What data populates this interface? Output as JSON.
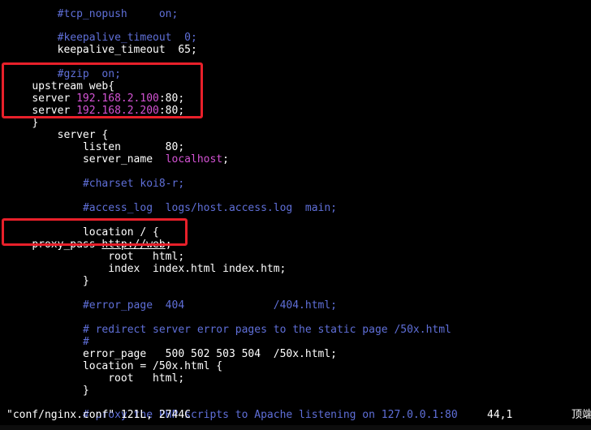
{
  "editor": {
    "lines": {
      "l1": {
        "indent": "    ",
        "text": "#tcp_nopush     on;"
      },
      "l2": {
        "indent": "    ",
        "text": "#keepalive_timeout  0;"
      },
      "l3": {
        "indent": "    ",
        "text": "keepalive_timeout  65;"
      },
      "l4": {
        "indent": "    ",
        "text": "#gzip  on;"
      },
      "l5": {
        "text": "upstream web{"
      },
      "l6": {
        "key": "server ",
        "ip": "192.168.2.100",
        "rest": ":80;"
      },
      "l7": {
        "key": "server ",
        "ip": "192.168.2.200",
        "rest": ":80;"
      },
      "l8": {
        "text": "}"
      },
      "l9": {
        "indent": "    ",
        "text": "server {"
      },
      "l10": {
        "indent": "        ",
        "text": "listen       80;"
      },
      "l11": {
        "indent": "        ",
        "key": "server_name  ",
        "val": "localhost",
        "rest": ";"
      },
      "l12": {
        "indent": "        ",
        "text": "#charset koi8-r;"
      },
      "l13": {
        "indent": "        ",
        "text": "#access_log  logs/host.access.log  main;"
      },
      "l14": {
        "indent": "        ",
        "text": "location / {"
      },
      "l15": {
        "key": "proxy_pass ",
        "url": "http://web",
        "rest": ";"
      },
      "l16": {
        "indent": "            ",
        "text": "root   html;"
      },
      "l17": {
        "indent": "            ",
        "text": "index  index.html index.htm;"
      },
      "l18": {
        "indent": "        ",
        "text": "}"
      },
      "l19": {
        "indent": "        ",
        "text": "#error_page  404              /404.html;"
      },
      "l20": {
        "indent": "        ",
        "text": "# redirect server error pages to the static page /50x.html"
      },
      "l21": {
        "indent": "        ",
        "text": "#"
      },
      "l22": {
        "indent": "        ",
        "text": "error_page   500 502 503 504  /50x.html;"
      },
      "l23": {
        "indent": "        ",
        "text": "location = /50x.html {"
      },
      "l24": {
        "indent": "            ",
        "text": "root   html;"
      },
      "l25": {
        "indent": "        ",
        "text": "}"
      },
      "l26": {
        "indent": "        ",
        "text": "# proxy the PHP scripts to Apache listening on 127.0.0.1:80"
      }
    }
  },
  "status_bar": {
    "file_info": "\"conf/nginx.conf\" 121L, 2744C",
    "cursor_pos": "44,1",
    "scroll_pos": "顶端"
  },
  "colors": {
    "background": "#000000",
    "comment": "#5f6fd8",
    "string": "#d453d4",
    "highlight_box": "#e8202a"
  }
}
